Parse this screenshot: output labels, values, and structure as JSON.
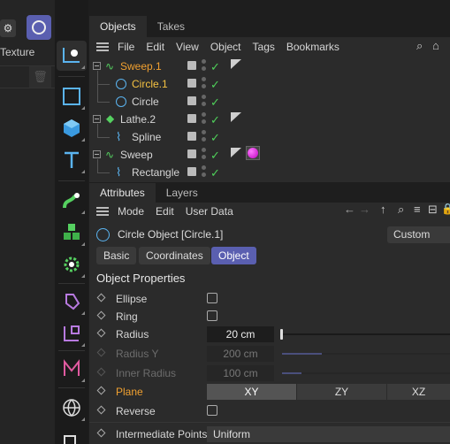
{
  "left_panel": {
    "texture_label": "Texture"
  },
  "object_manager": {
    "tabs": [
      "Objects",
      "Takes"
    ],
    "menu": [
      "File",
      "Edit",
      "View",
      "Object",
      "Tags",
      "Bookmarks"
    ],
    "rows": [
      {
        "name": "Sweep.1",
        "icon": "sweep-icon",
        "state": "selected-orange"
      },
      {
        "name": "Circle.1",
        "icon": "circle-spline-icon",
        "state": "selected-yellow"
      },
      {
        "name": "Circle",
        "icon": "circle-spline-icon",
        "state": "normal"
      },
      {
        "name": "Lathe.2",
        "icon": "lathe-icon",
        "state": "normal"
      },
      {
        "name": "Spline",
        "icon": "spline-icon",
        "state": "normal"
      },
      {
        "name": "Sweep",
        "icon": "sweep-icon",
        "state": "normal"
      },
      {
        "name": "Rectangle",
        "icon": "spline-icon",
        "state": "normal"
      }
    ]
  },
  "attribute_manager": {
    "tabs": [
      "Attributes",
      "Layers"
    ],
    "menu": [
      "Mode",
      "Edit",
      "User Data"
    ],
    "object_title": "Circle Object [Circle.1]",
    "preset": "Custom",
    "subtabs": [
      "Basic",
      "Coordinates",
      "Object"
    ],
    "active_subtab": "Object",
    "section": "Object Properties",
    "props": {
      "ellipse": "Ellipse",
      "ring": "Ring",
      "radius": "Radius",
      "radius_value": "20 cm",
      "radius_y": "Radius Y",
      "radius_y_value": "200 cm",
      "inner_radius": "Inner Radius",
      "inner_radius_value": "100 cm",
      "plane": "Plane",
      "plane_options": [
        "XY",
        "ZY",
        "XZ"
      ],
      "plane_selected": "XY",
      "reverse": "Reverse",
      "intermediate_points": "Intermediate Points",
      "intermediate_points_value": "Uniform"
    }
  },
  "colors": {
    "accent": "#5a5fb0",
    "selected_orange": "#f0a030",
    "check_green": "#4fd05a"
  }
}
